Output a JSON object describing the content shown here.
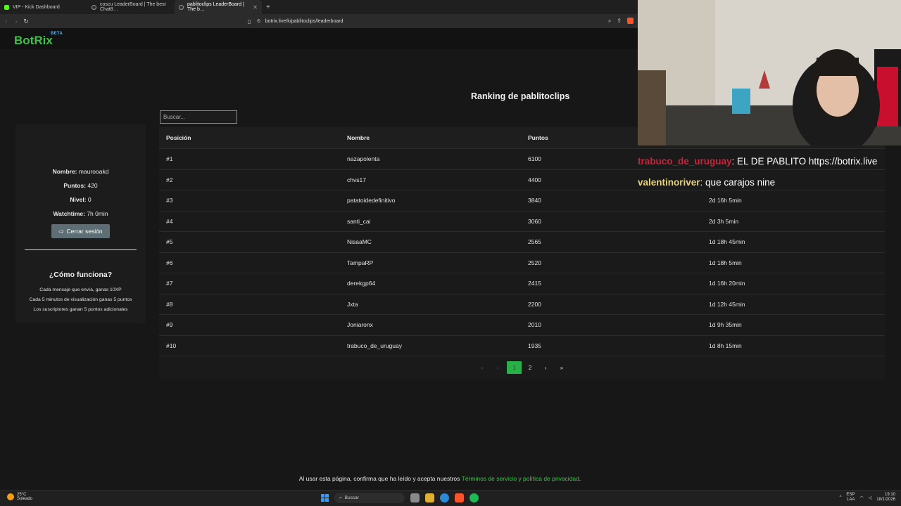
{
  "browser": {
    "tabs": [
      {
        "label": "VIP - Kick Dashboard",
        "active": false
      },
      {
        "label": "coscu LeaderBoard | The best Chat8…",
        "active": false
      },
      {
        "label": "pablitoclips LeaderBoard | The b…",
        "active": true
      }
    ],
    "new_tab": "+",
    "url": "botrix.live/k/pablitoclips/leaderboard"
  },
  "site": {
    "logo": "BotRix",
    "beta": "BETA",
    "page_title": "Ranking de pablitoclips",
    "search_placeholder": "Buscar..."
  },
  "user_panel": {
    "name_label": "Nombre:",
    "name_value": "maurooakd",
    "points_label": "Puntos:",
    "points_value": "420",
    "level_label": "Nivel:",
    "level_value": "0",
    "watchtime_label": "Watchtime:",
    "watchtime_value": "7h 0min",
    "logout_label": "Cerrar sesión",
    "how_title": "¿Cómo funciona?",
    "how_lines": [
      "Cada mensaje que envía, ganas 10XP",
      "Cada 5 minutos de visualización ganas 5 puntos",
      "Los suscriptores ganan 5 puntos adicionales"
    ]
  },
  "leaderboard": {
    "headers": [
      "Posición",
      "Nombre",
      "Puntos",
      ""
    ],
    "rows": [
      {
        "pos": "#1",
        "name": "nazapolenta",
        "points": "6100",
        "watch": ""
      },
      {
        "pos": "#2",
        "name": "chvs17",
        "points": "4400",
        "watch": ""
      },
      {
        "pos": "#3",
        "name": "patatoidedefinitivo",
        "points": "3840",
        "watch": "2d 16h 5min"
      },
      {
        "pos": "#4",
        "name": "santi_cai",
        "points": "3060",
        "watch": "2d 3h 5min"
      },
      {
        "pos": "#5",
        "name": "NisaaMC",
        "points": "2565",
        "watch": "1d 18h 45min"
      },
      {
        "pos": "#6",
        "name": "TampaRP",
        "points": "2520",
        "watch": "1d 18h 5min"
      },
      {
        "pos": "#7",
        "name": "derekgp64",
        "points": "2415",
        "watch": "1d 16h 20min"
      },
      {
        "pos": "#8",
        "name": "Jxta",
        "points": "2200",
        "watch": "1d 12h 45min"
      },
      {
        "pos": "#9",
        "name": "Joniaronx",
        "points": "2010",
        "watch": "1d 9h 35min"
      },
      {
        "pos": "#10",
        "name": "trabuco_de_uruguay",
        "points": "1935",
        "watch": "1d 8h 15min"
      }
    ],
    "pagination": {
      "first": "«",
      "prev": "‹",
      "current": "1",
      "next_page": "2",
      "next": "›",
      "last": "»"
    }
  },
  "overlay_chat": [
    {
      "user": "trabuco_de_uruguay",
      "message": ": EL DE PABLITO https://botrix.live"
    },
    {
      "user": "valentinoriver",
      "message": ": que carajos nine"
    }
  ],
  "footer": {
    "text": "Al usar esta página, confirma que ha leído y acepta nuestros",
    "link": "Términos de servicio y política de privacidad",
    "end": "."
  },
  "taskbar": {
    "temp": "25°C",
    "weather": "Soleado",
    "search": "Buscar",
    "lang1": "ESP",
    "lang2": "LAA",
    "time": "19:10",
    "date": "18/1/2026"
  }
}
